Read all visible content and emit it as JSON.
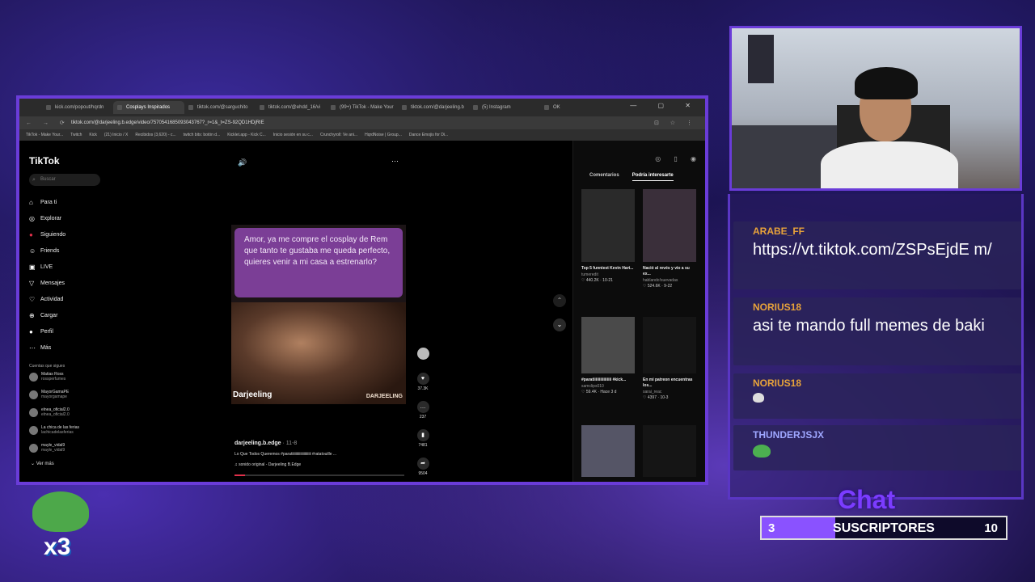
{
  "browser": {
    "tabs": [
      "kick.com/popout/hqrdn",
      "Cosplays Inspirados",
      "tiktok.com/@sarguchito",
      "tiktok.com/@ehdd_16/vi",
      "(99+) TikTok - Make Your",
      "tiktok.com/@darjeeling.b",
      "(5) Instagram",
      "OK"
    ],
    "url": "tiktok.com/@darjeeling.b.edge/video/7570541685093043767?_r=1&_t=ZS-92QD1HDjRIE",
    "bookmarks": [
      "TikTok - Make Your...",
      "Twitch",
      "Kick",
      "(21) Inicio / X",
      "Recibidos (3,620) - c...",
      "twitch bits: botón d...",
      "Kicklet.app - Kick C...",
      "Inicio sesión en su c...",
      "Crunchyroll: Ve ani...",
      "HqrdNoise | Group...",
      "Dance Emojis for Di..."
    ]
  },
  "tiktok": {
    "logo": "TikTok",
    "search_placeholder": "Buscar",
    "nav": [
      {
        "label": "Para ti",
        "icon": "home-icon"
      },
      {
        "label": "Explorar",
        "icon": "compass-icon"
      },
      {
        "label": "Siguiendo",
        "icon": "following-icon"
      },
      {
        "label": "Friends",
        "icon": "friends-icon"
      },
      {
        "label": "LIVE",
        "icon": "live-icon"
      },
      {
        "label": "Mensajes",
        "icon": "messages-icon"
      },
      {
        "label": "Actividad",
        "icon": "activity-icon"
      },
      {
        "label": "Cargar",
        "icon": "upload-icon"
      },
      {
        "label": "Perfil",
        "icon": "profile-icon"
      },
      {
        "label": "Más",
        "icon": "more-icon"
      }
    ],
    "following_title": "Cuentas que sigues",
    "accounts": [
      {
        "name": "Matias Ross",
        "handle": "rossperfumes"
      },
      {
        "name": "MayorGamaPE",
        "handle": "mayorgamape"
      },
      {
        "name": "elnea_oficial2.0",
        "handle": "elnea_oficial2.0"
      },
      {
        "name": "La chica de las ferias",
        "handle": "lachicadelasferias"
      },
      {
        "name": "mayle_vidal9",
        "handle": "mayle_vidal9"
      }
    ],
    "see_more": "Ver más",
    "video": {
      "bubble": "Amor, ya me compre el cosplay de Rem que tanto te gustaba me queda perfecto, quieres venir a mi casa a estrenarlo?",
      "watermark": "Darjeeling",
      "watermark2": "DARJEELING",
      "progress": 0.06
    },
    "actions": [
      {
        "icon": "heart-icon",
        "count": "37.3K"
      },
      {
        "icon": "comment-icon",
        "count": "237"
      },
      {
        "icon": "bookmark-icon",
        "count": "7481"
      },
      {
        "icon": "share-icon",
        "count": "9504"
      }
    ],
    "author": "darjeeling.b.edge",
    "date": "· 11-8",
    "description": "Lo Que Todos Queremos #paratiiiiiiiiiiiiiiiiiiiii #ratatouille ...",
    "sound": "♫ sonido original - Darjeeling B.Edge",
    "right_tabs": [
      "Comentarios",
      "Podría interesarte"
    ],
    "suggestions": [
      {
        "title": "Top 5 funniest Kevin Hart...",
        "author": "tumeredit",
        "meta": "♡ 440.2K · 10-21"
      },
      {
        "title": "Nació al revés y vio a su ex...",
        "author": "hablando!suevadas",
        "meta": "♡ 524.6K · 9-22"
      },
      {
        "title": "#paratiiiiiiiiiiiiiiii #kick...",
        "author": "samclips010",
        "meta": "♡ 59.4K · Hace 3 d"
      },
      {
        "title": "En mi patreon encuentras los...",
        "author": "sarai_reac",
        "meta": "♡ 4397 · 10-3"
      }
    ]
  },
  "chat": {
    "messages": [
      {
        "author": "ARABE_FF",
        "text": "https://vt.tiktok.com/ZSPsEjdE m/"
      },
      {
        "author": "NORIUS18",
        "text": "asi te mando full memes de baki"
      },
      {
        "author": "NORIUS18",
        "text": ""
      },
      {
        "author": "THUNDERJSJX",
        "text": ""
      }
    ],
    "label": "Chat"
  },
  "subs": {
    "current": "3",
    "label": "SUSCRIPTORES",
    "goal": "10",
    "progress": 0.3
  },
  "overlay": {
    "multiplier": "x3"
  },
  "colors": {
    "accent": "#6a3cd8",
    "chat_author": "#e8a33a",
    "tiktok_red": "#e0304a"
  }
}
